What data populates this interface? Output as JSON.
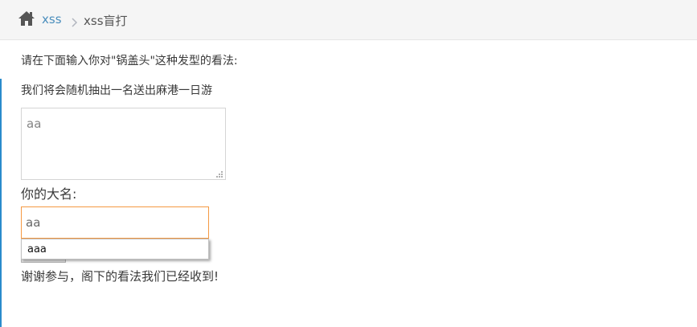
{
  "breadcrumb": {
    "home_icon": "home-icon",
    "parent_label": "xss",
    "separator_icon": "chevron-right-icon",
    "current_label": "xss盲打"
  },
  "form": {
    "prompt_line_1": "请在下面输入你对\"锅盖头\"这种发型的看法:",
    "prompt_line_2": "我们将会随机抽出一名送出麻港一日游",
    "opinion_value": "aa",
    "name_label": "你的大名:",
    "name_value": "aa",
    "autocomplete_option": "aaa",
    "submit_label": ""
  },
  "result": {
    "message": "谢谢参与，阁下的看法我们已经收到!"
  },
  "colors": {
    "breadcrumb_bg": "#f5f5f5",
    "link": "#4c8fbd",
    "focus_border": "#f59942",
    "accent_bar": "#2a8bcc",
    "text": "#393939"
  }
}
